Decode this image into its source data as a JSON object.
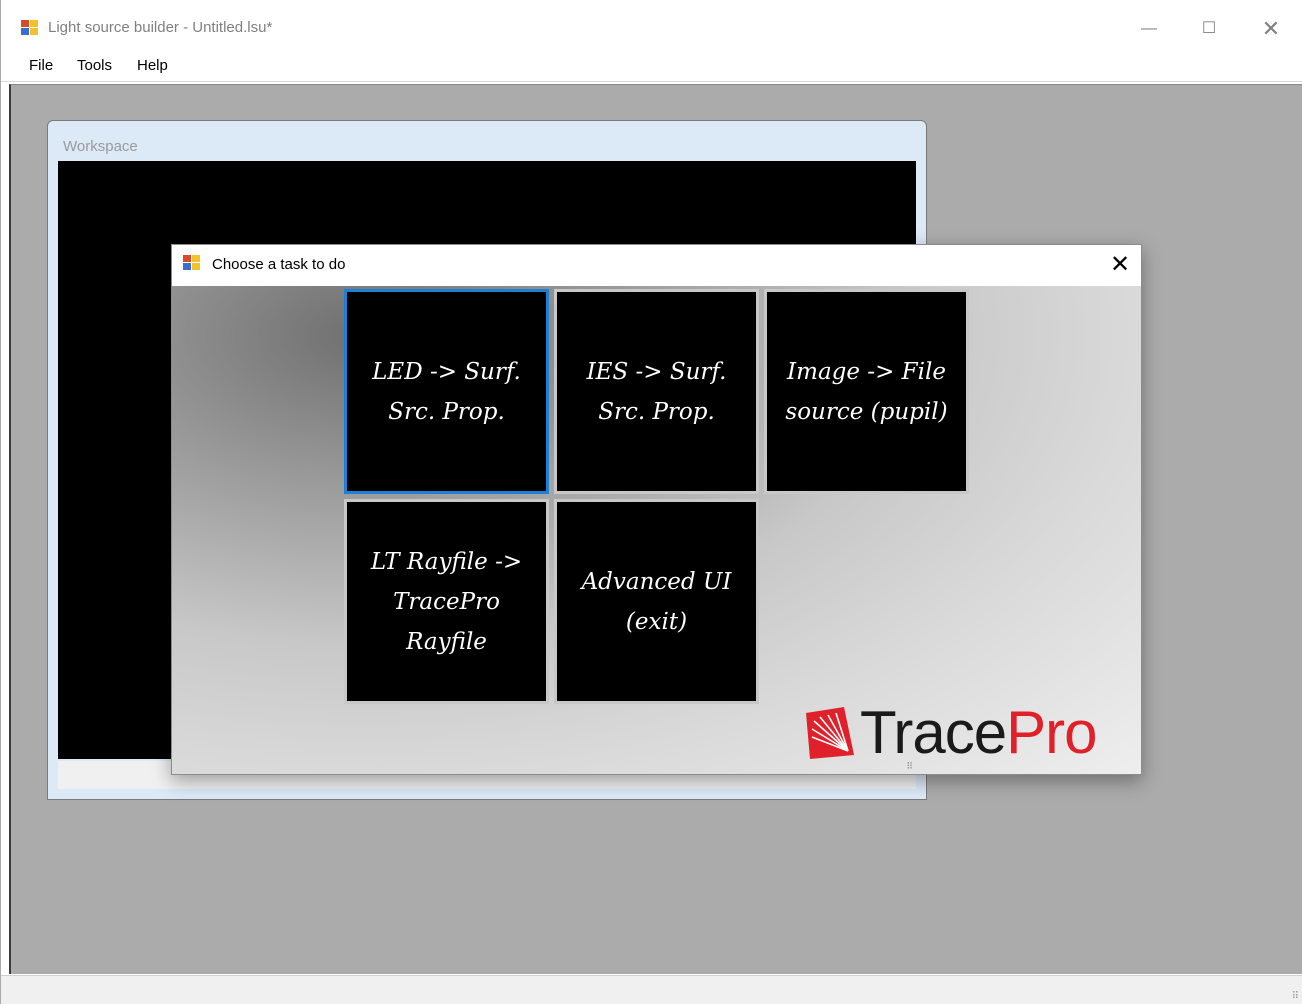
{
  "window": {
    "title": "Light source builder - Untitled.lsu*",
    "controls": {
      "minimize": "—",
      "maximize": "☐",
      "close": "✕"
    }
  },
  "menubar": {
    "items": [
      "File",
      "Tools",
      "Help"
    ]
  },
  "workspace": {
    "title": "Workspace"
  },
  "dialog": {
    "title": "Choose a task to do",
    "close": "✕",
    "tasks": [
      {
        "label": "LED -> Surf.\nSrc. Prop.",
        "selected": true
      },
      {
        "label": "IES -> Surf.\nSrc. Prop.",
        "selected": false
      },
      {
        "label": "Image -> File\nsource (pupil)",
        "selected": false
      },
      {
        "label": "LT Rayfile ->\nTracePro\nRayfile",
        "selected": false
      },
      {
        "label": "Advanced UI\n(exit)",
        "selected": false
      }
    ],
    "logo": {
      "part1": "Trace",
      "part2": "Pro"
    }
  },
  "colors": {
    "selection_border": "#1d7fd6",
    "logo_red": "#e0202a",
    "tile_bg": "#000000",
    "mdi_bg": "#ababab"
  }
}
